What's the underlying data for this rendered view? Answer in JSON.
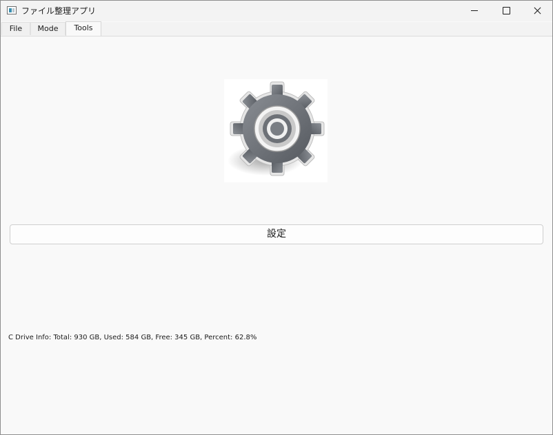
{
  "window": {
    "title": "ファイル整理アプリ"
  },
  "tabs": [
    {
      "label": "File"
    },
    {
      "label": "Mode"
    },
    {
      "label": "Tools"
    }
  ],
  "active_tab": "Tools",
  "main": {
    "settings_icon": "gear-icon",
    "settings_button_label": "設定",
    "drive_info": "C Drive Info: Total: 930 GB, Used: 584 GB, Free: 345 GB, Percent: 62.8%"
  },
  "colors": {
    "window_bg": "#f9f9f9",
    "gear": "#6d7177"
  }
}
